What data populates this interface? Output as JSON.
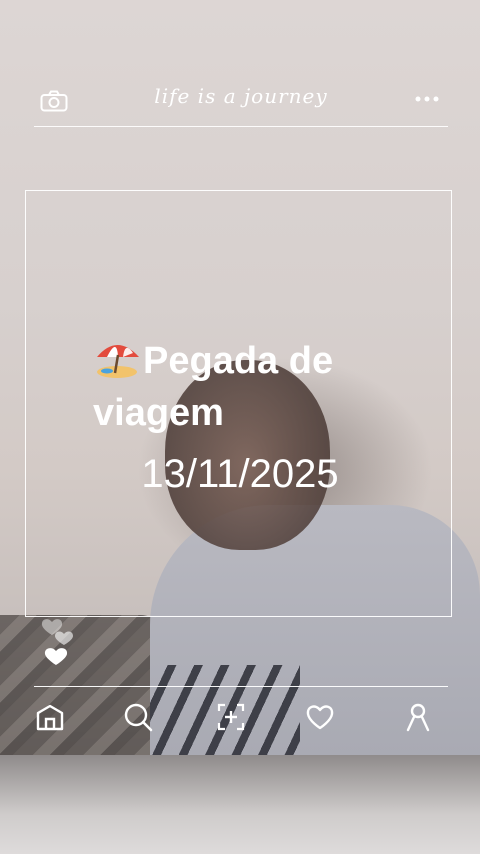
{
  "header": {
    "tagline": "life is a journey",
    "left_icon": "camera-icon",
    "right_icon": "more-dots-icon"
  },
  "post": {
    "title": "Pegada de viagem",
    "emoji": "beach-umbrella-emoji",
    "date": "13/11/2025"
  },
  "reactions": {
    "icon": "heart-icon"
  },
  "nav": {
    "items": [
      {
        "name": "home",
        "icon": "home-icon"
      },
      {
        "name": "search",
        "icon": "search-icon"
      },
      {
        "name": "add",
        "icon": "add-post-icon"
      },
      {
        "name": "likes",
        "icon": "heart-outline-icon"
      },
      {
        "name": "profile",
        "icon": "profile-icon"
      }
    ]
  },
  "colors": {
    "overlay": "#ffffff",
    "background": "#d9d2cf"
  }
}
